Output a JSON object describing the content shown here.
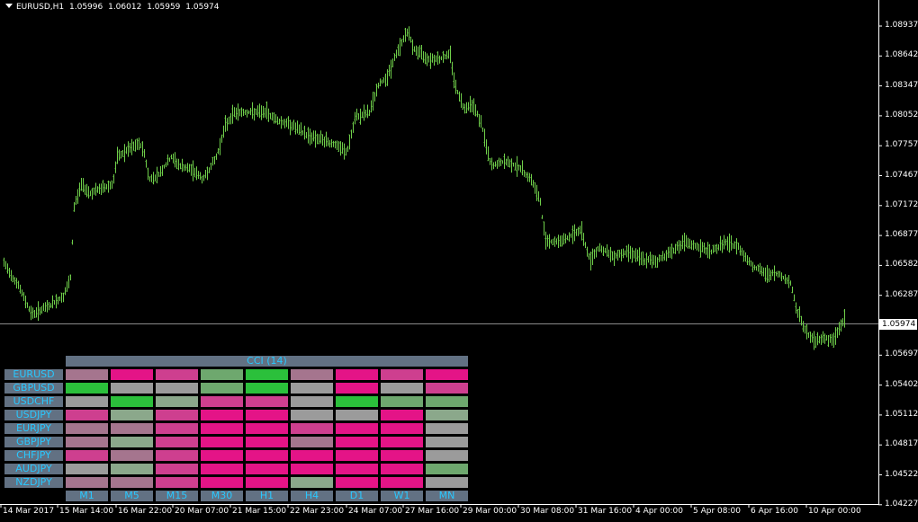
{
  "header": {
    "symbol": "EURUSD,H1",
    "open": "1.05996",
    "high": "1.06012",
    "low": "1.05959",
    "close": "1.05974"
  },
  "price_axis": [
    "1.08937",
    "1.08642",
    "1.08347",
    "1.08052",
    "1.07757",
    "1.07467",
    "1.07172",
    "1.06877",
    "1.06582",
    "1.06287",
    "1.05974",
    "1.05697",
    "1.05402",
    "1.05112",
    "1.04817",
    "1.04522",
    "1.04227"
  ],
  "current_price": "1.05974",
  "time_axis": [
    "14 Mar 2017",
    "15 Mar 14:00",
    "16 Mar 22:00",
    "20 Mar 07:00",
    "21 Mar 15:00",
    "22 Mar 23:00",
    "24 Mar 07:00",
    "27 Mar 16:00",
    "29 Mar 00:00",
    "30 Mar 08:00",
    "31 Mar 16:00",
    "4 Apr 00:00",
    "5 Apr 08:00",
    "6 Apr 16:00",
    "10 Apr 00:00"
  ],
  "colors": {
    "background": "#000000",
    "candle": "#6fcf4a",
    "axis": "#ffffff",
    "panel": "#627183",
    "panel_text": "#29c8ff"
  },
  "cci": {
    "title": "CCI (14)",
    "symbols": [
      "EURUSD",
      "GBPUSD",
      "USDCHF",
      "USDJPY",
      "EURJPY",
      "GBPJPY",
      "CHFJPY",
      "AUDJPY",
      "NZDJPY"
    ],
    "timeframes": [
      "M1",
      "M5",
      "M15",
      "M30",
      "H1",
      "H4",
      "D1",
      "W1",
      "MN"
    ],
    "palette": {
      "G": "#2bc03b",
      "g": "#6ea86e",
      "l": "#8ba88b",
      "n": "#9b9b9b",
      "m": "#a5758e",
      "p": "#ce3f8f",
      "r": "#e41487"
    },
    "grid": [
      [
        "m",
        "r",
        "p",
        "g",
        "G",
        "m",
        "r",
        "p",
        "r"
      ],
      [
        "G",
        "n",
        "n",
        "g",
        "G",
        "n",
        "r",
        "n",
        "p"
      ],
      [
        "n",
        "G",
        "l",
        "p",
        "p",
        "n",
        "G",
        "g",
        "g"
      ],
      [
        "p",
        "l",
        "p",
        "r",
        "r",
        "n",
        "n",
        "r",
        "l"
      ],
      [
        "m",
        "m",
        "p",
        "r",
        "r",
        "p",
        "r",
        "r",
        "n"
      ],
      [
        "m",
        "l",
        "p",
        "r",
        "r",
        "m",
        "r",
        "r",
        "n"
      ],
      [
        "p",
        "m",
        "p",
        "r",
        "r",
        "r",
        "r",
        "r",
        "n"
      ],
      [
        "n",
        "l",
        "p",
        "r",
        "r",
        "r",
        "r",
        "r",
        "g"
      ],
      [
        "m",
        "m",
        "p",
        "r",
        "r",
        "l",
        "r",
        "r",
        "n"
      ]
    ]
  }
}
